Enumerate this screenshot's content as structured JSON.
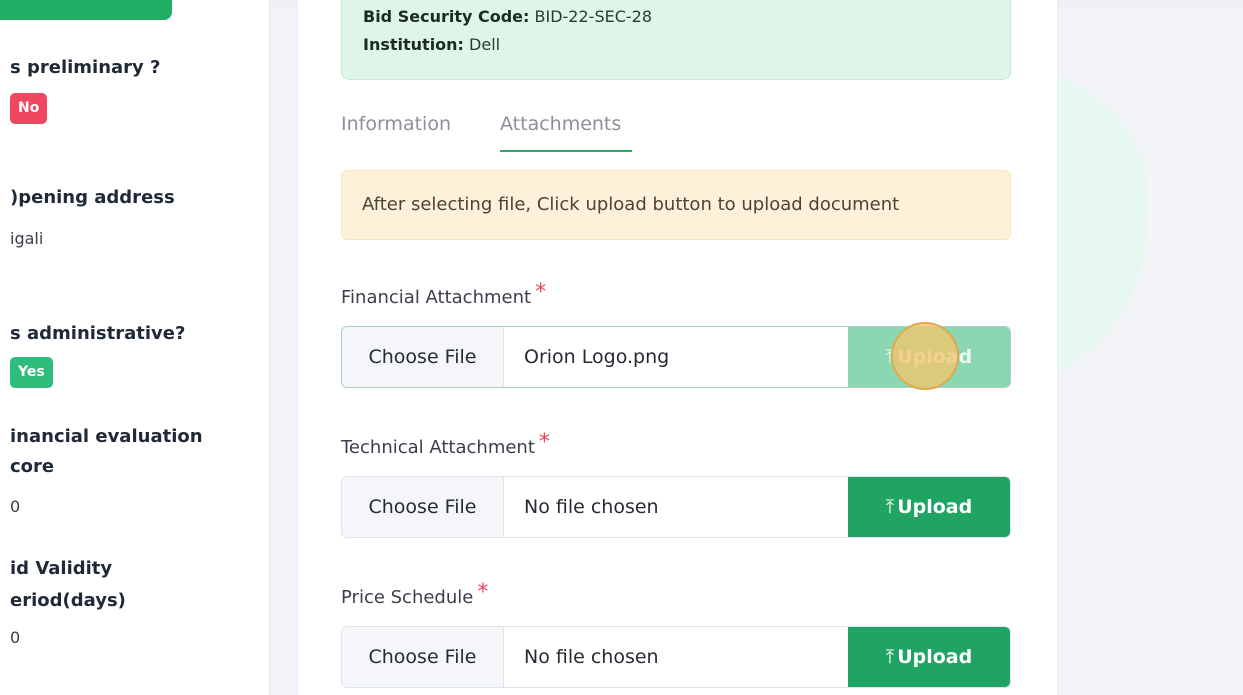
{
  "sidebar": {
    "preliminary_title": "s preliminary ?",
    "preliminary_badge": "No",
    "opening_title": ")pening address",
    "opening_value": "igali",
    "administrative_title": "s administrative?",
    "administrative_badge": "Yes",
    "financial_title_line1": "inancial evaluation",
    "financial_title_line2": "core",
    "financial_value": "0",
    "validity_title_line1": "id Validity",
    "validity_title_line2": "eriod(days)",
    "validity_value": "0"
  },
  "info_box": {
    "security_label": "Bid Security Code:",
    "security_value": "BID-22-SEC-28",
    "institution_label": "Institution:",
    "institution_value": "Dell"
  },
  "tabs": [
    {
      "label": "Information",
      "active": false
    },
    {
      "label": "Attachments",
      "active": true
    }
  ],
  "alert_text": "After selecting file, Click upload button to upload document",
  "attachments": [
    {
      "label": "Financial Attachment",
      "required_mark": "*",
      "choose_label": "Choose File",
      "file_name": "Orion Logo.png",
      "upload_label": "Upload",
      "upload_disabled": true
    },
    {
      "label": "Technical Attachment",
      "required_mark": "*",
      "choose_label": "Choose File",
      "file_name": "No file chosen",
      "upload_label": "Upload",
      "upload_disabled": false
    },
    {
      "label": "Price Schedule",
      "required_mark": "*",
      "choose_label": "Choose File",
      "file_name": "No file chosen",
      "upload_label": "Upload",
      "upload_disabled": false
    }
  ],
  "icons": {
    "upload": "upload-icon",
    "upload_glyph": "⤒"
  },
  "colors": {
    "primary_green": "#1fa463",
    "danger_red": "#ef4760",
    "alert_bg": "#fdf2d9",
    "info_bg": "#dff5e8"
  }
}
